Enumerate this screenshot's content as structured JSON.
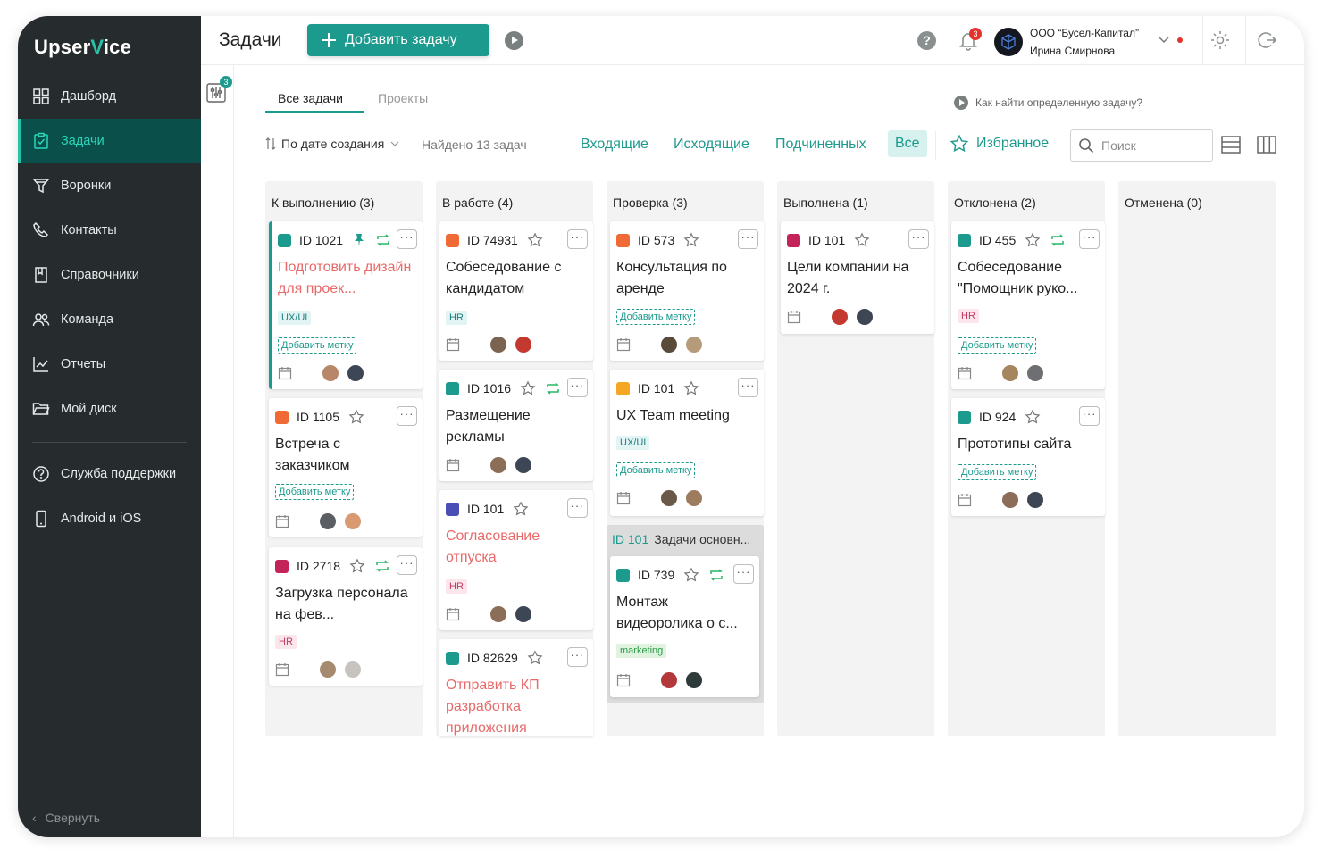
{
  "app": {
    "brand": "UpserVice",
    "brand_a": "Upser",
    "brand_v": "V",
    "brand_b": "ice"
  },
  "sidebar": {
    "items": [
      {
        "label": "Дашборд",
        "icon": "dashboard-icon"
      },
      {
        "label": "Задачи",
        "icon": "tasks-icon",
        "active": true
      },
      {
        "label": "Воронки",
        "icon": "funnel-icon"
      },
      {
        "label": "Контакты",
        "icon": "phone-icon"
      },
      {
        "label": "Справочники",
        "icon": "book-icon"
      },
      {
        "label": "Команда",
        "icon": "team-icon"
      },
      {
        "label": "Отчеты",
        "icon": "chart-icon"
      },
      {
        "label": "Мой диск",
        "icon": "folder-icon"
      }
    ],
    "bottom_items": [
      {
        "label": "Служба поддержки",
        "icon": "support-icon"
      },
      {
        "label": "Android и iOS",
        "icon": "mobile-icon"
      }
    ],
    "collapse_label": "Свернуть"
  },
  "header": {
    "title": "Задачи",
    "add_button": "Добавить задачу",
    "notifications_count": "3",
    "company": "ООО “Бусел-Капитал”",
    "user": "Ирина Смирнова"
  },
  "filters_badge": "3",
  "tabs": [
    "Все задачи",
    "Проекты"
  ],
  "howto": "Как найти определенную задачу?",
  "toolbar": {
    "sort_label": "По дате создания",
    "found": "Найдено 13 задач",
    "filters": [
      "Входящие",
      "Исходящие",
      "Подчиненных",
      "Все"
    ],
    "favorites": "Избранное",
    "search_placeholder": "Поиск"
  },
  "colors": {
    "accent": "#1c9a8e",
    "sidebar_bg": "#262b2d",
    "danger": "#e5322d"
  },
  "columns": [
    {
      "title": "К выполнению (3)",
      "cards": [
        {
          "id": "ID 1021",
          "title": "Подготовить дизайн для проек...",
          "title_red": true,
          "type": "list",
          "pinned": true,
          "repeat": true,
          "tag": "UX/UI",
          "add_tag": "Добавить метку",
          "selected": true
        },
        {
          "id": "ID 1105",
          "title": "Встреча с заказчиком",
          "type": "meeting",
          "add_tag": "Добавить метку"
        },
        {
          "id": "ID 2718",
          "title": "Загрузка персонала на фев...",
          "type": "view",
          "repeat": true,
          "tag": "HR"
        }
      ]
    },
    {
      "title": "В работе (4)",
      "cards": [
        {
          "id": "ID 74931",
          "title": "Собеседование с кандидатом",
          "type": "meeting",
          "tag": "HR"
        },
        {
          "id": "ID 1016",
          "title": "Размещение рекламы",
          "type": "list",
          "repeat": true
        },
        {
          "id": "ID 101",
          "title": "Согласование отпуска",
          "title_red": true,
          "type": "approve",
          "tag": "HR"
        },
        {
          "id": "ID 82629",
          "title": "Отправить КП разработка приложения",
          "title_red": true,
          "type": "list"
        }
      ]
    },
    {
      "title": "Проверка (3)",
      "cards": [
        {
          "id": "ID 573",
          "title": "Консультация по аренде",
          "type": "meeting",
          "add_tag": "Добавить метку"
        },
        {
          "id": "ID 101",
          "title": "UX Team meeting",
          "type": "call",
          "tag": "UX/UI",
          "add_tag": "Добавить метку"
        }
      ],
      "subgroup": {
        "id": "ID 101",
        "title": "Задачи основн...",
        "card": {
          "id": "ID 739",
          "title": "Монтаж видеоролика о с...",
          "type": "list",
          "repeat": true,
          "tag": "marketing"
        }
      }
    },
    {
      "title": "Выполнена (1)",
      "cards": [
        {
          "id": "ID 101",
          "title": "Цели компании на 2024 г.",
          "type": "view"
        }
      ]
    },
    {
      "title": "Отклонена (2)",
      "cards": [
        {
          "id": "ID 455",
          "title": "Собеседование \"Помощник руко...",
          "type": "list",
          "repeat": true,
          "tag": "HR",
          "add_tag": "Добавить метку"
        },
        {
          "id": "ID 924",
          "title": "Прототипы сайта",
          "type": "list",
          "add_tag": "Добавить метку"
        }
      ]
    },
    {
      "title": "Отменена (0)",
      "cards": []
    }
  ]
}
